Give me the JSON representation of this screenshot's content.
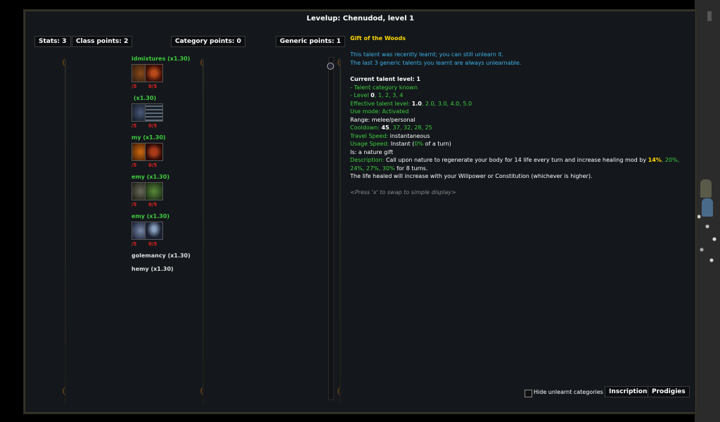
{
  "window": {
    "title": "Levelup: Chenudod, level 1"
  },
  "points": {
    "stats": "Stats: 3",
    "class": "Class points: 2",
    "category": "Category points: 0",
    "generic": "Generic points: 1"
  },
  "categories": [
    {
      "label": "idmixtures (x1.30)",
      "pts": [
        "/5",
        "0/5"
      ],
      "icons": [
        "brown-fire-icon",
        "red-spiral-icon"
      ]
    },
    {
      "label": "(x1.30)",
      "pts": [
        "/5",
        "0/5"
      ],
      "icons": [
        "blue-shadow-icon",
        "grid-icon"
      ]
    },
    {
      "label": "my (x1.30)",
      "pts": [
        "/5",
        "0/5"
      ],
      "icons": [
        "orange-flame-icon",
        "red-claw-icon"
      ]
    },
    {
      "label": "emy (x1.30)",
      "pts": [
        "/5",
        "0/5"
      ],
      "icons": [
        "skull-icon",
        "green-paw-icon"
      ]
    },
    {
      "label": "emy (x1.30)",
      "pts": [
        "/5",
        "0/5"
      ],
      "icons": [
        "shards-icon",
        "golem-icon"
      ]
    }
  ],
  "collapsed_categories": [
    "golemancy (x1.30)",
    "hemy (x1.30)"
  ],
  "talent": {
    "name": "Gift of the Woods",
    "recent1": "This talent was recently learnt; you can still unlearn it.",
    "recent2": "The last 3  generic talents you learnt are always unlearnable.",
    "current_level": "Current talent level: 1",
    "cat_known": "- Talent category known",
    "level_prefix": "- Level ",
    "level_cur": "0",
    "level_rest": ", 1, 2, 3, 4",
    "eff_label": "Effective talent level: ",
    "eff_cur": "1.0",
    "eff_rest": ", 2.0, 3.0, 4.0, 5.0",
    "use_mode_label": "Use mode: ",
    "use_mode": "Activated",
    "range_label": "Range: ",
    "range": "melee/personal",
    "cooldown_label": "Cooldown: ",
    "cooldown_cur": "45",
    "cooldown_rest": ", 37, 32, 28, 25",
    "travel_label": "Travel Speed: ",
    "travel": "instantaneous",
    "usage_label": "Usage Speed: ",
    "usage_a": "Instant (",
    "usage_b": "0%",
    "usage_c": " of a turn)",
    "is": "Is: a nature gift",
    "description_label": "Description: ",
    "description_a": "Call upon nature to regenerate your body for 14 life every turn and increase healing mod by ",
    "d_14": "14%",
    "d_20": ", 20%,",
    "d_24": "24%",
    "d_27": ", 27%",
    "d_30": ", 30%",
    "description_b": " for 8 turns.",
    "description_c": "The life healed will increase with your Willpower or Constitution (whichever is higher).",
    "hint": "<Press 'x' to swap to simple display>"
  },
  "footer": {
    "hide_label": "Hide unlearnt categories",
    "inscriptions": "Inscriptions",
    "prodigies": "Prodigies"
  },
  "colors": {
    "talent_name": "#ffd700",
    "info": "#3fb0e8",
    "known": "#3ecb3e",
    "points_red": "#e02020"
  }
}
